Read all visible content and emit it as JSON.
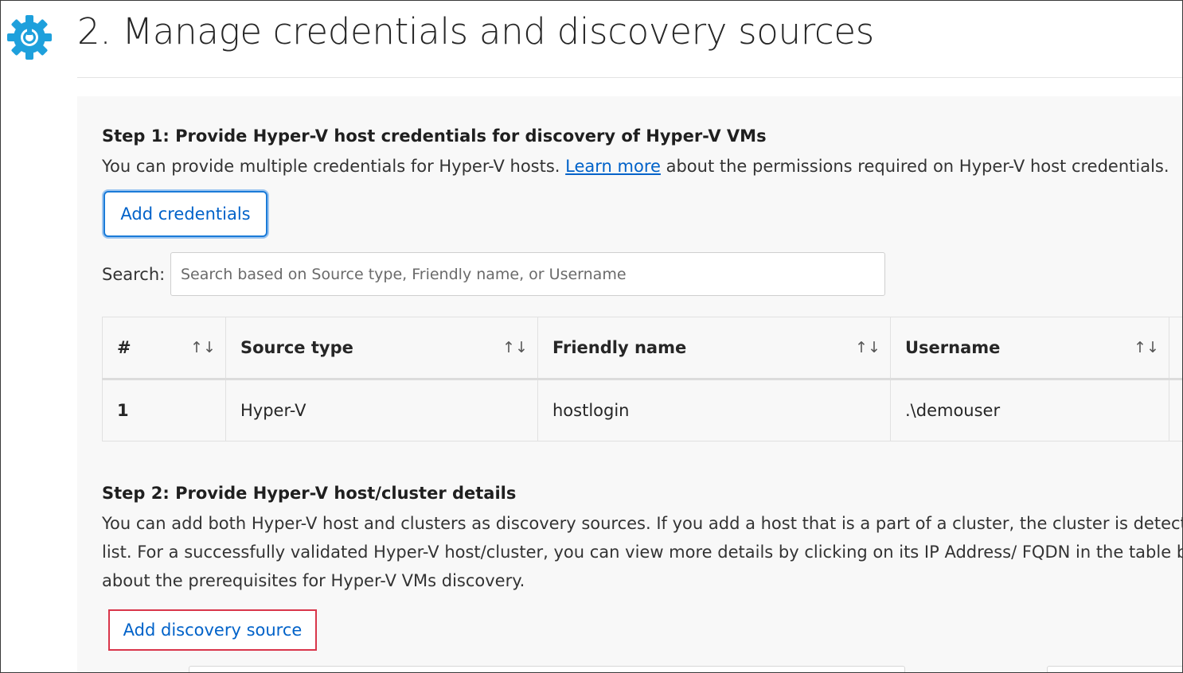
{
  "header": {
    "title": "2. Manage credentials and discovery sources",
    "icon": "gear-icon",
    "icon_color": "#1ea0dc"
  },
  "step1": {
    "heading": "Step 1: Provide Hyper-V host credentials for discovery of Hyper-V VMs",
    "text_before_link": "You can provide multiple credentials for Hyper-V hosts. ",
    "link_text": "Learn more",
    "text_after_link": " about the permissions required on Hyper-V host credentials.",
    "add_button_label": "Add credentials"
  },
  "search": {
    "label": "Search:",
    "placeholder": "Search based on Source type, Friendly name, or Username"
  },
  "table": {
    "columns": [
      "#",
      "Source type",
      "Friendly name",
      "Username"
    ],
    "sort_icon": "↑↓",
    "rows": [
      [
        "1",
        "Hyper-V",
        "hostlogin",
        ".\\demouser"
      ]
    ]
  },
  "step2": {
    "heading": "Step 2: Provide Hyper-V host/cluster details",
    "line1": "You can add both Hyper-V host and clusters as discovery sources. If you add a host that is a part of a cluster, the cluster is detect",
    "line2": "list. For a successfully validated Hyper-V host/cluster, you can view more details by clicking on its IP Address/ FQDN in the table b",
    "line3": "about the prerequisites for Hyper-V VMs discovery.",
    "add_button_label": "Add discovery source"
  },
  "colors": {
    "accent": "#0062c9",
    "highlight_border": "#d9364a",
    "panel_bg": "#f8f8f8"
  }
}
